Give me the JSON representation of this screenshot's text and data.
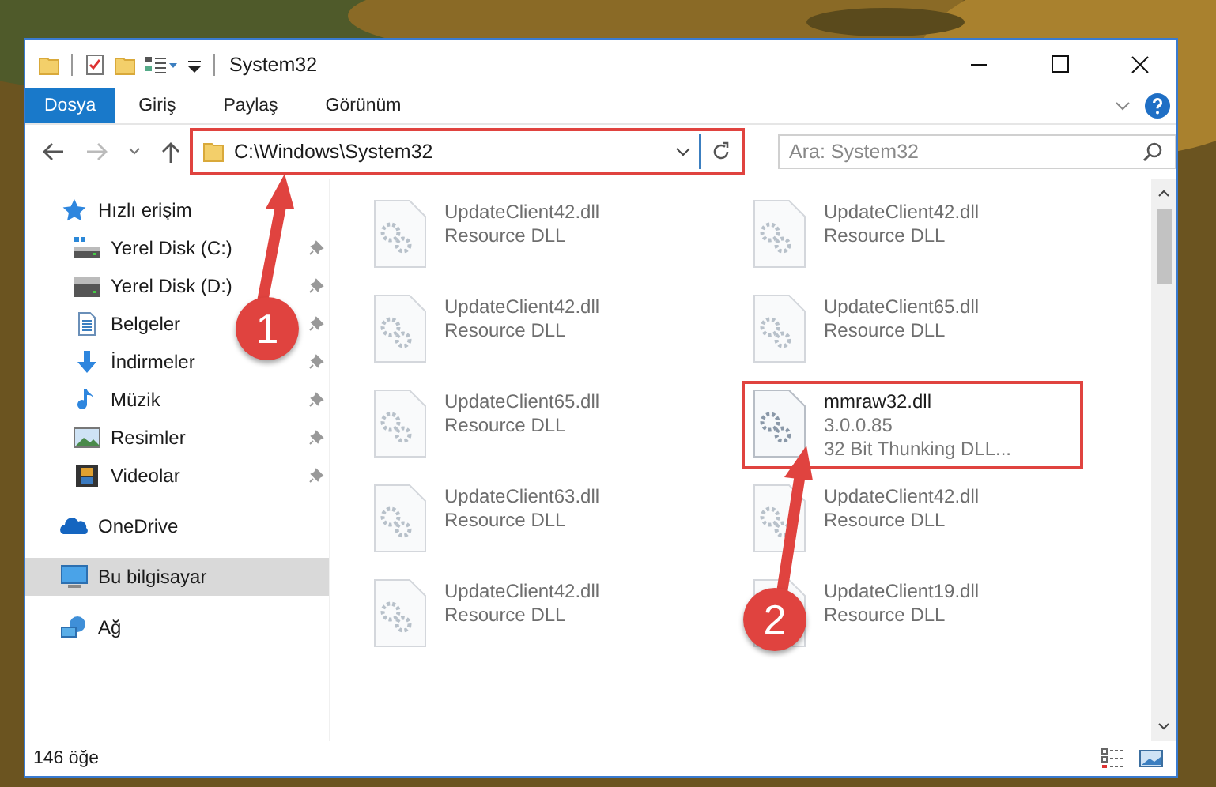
{
  "window": {
    "title": "System32"
  },
  "ribbon_tabs": [
    {
      "label": "Dosya",
      "selected": true
    },
    {
      "label": "Giriş",
      "selected": false
    },
    {
      "label": "Paylaş",
      "selected": false
    },
    {
      "label": "Görünüm",
      "selected": false
    }
  ],
  "address": {
    "path": "C:\\Windows\\System32",
    "highlighted": true
  },
  "search": {
    "placeholder": "Ara: System32"
  },
  "sidebar": {
    "items": [
      {
        "label": "Hızlı erişim",
        "kind": "star",
        "selected": false,
        "children": [
          {
            "label": "Yerel Disk (C:)",
            "kind": "drive-c",
            "pinned": true,
            "selected": false
          },
          {
            "label": "Yerel Disk (D:)",
            "kind": "drive",
            "pinned": true,
            "selected": false
          },
          {
            "label": "Belgeler",
            "kind": "document",
            "pinned": true,
            "selected": false
          },
          {
            "label": "İndirmeler",
            "kind": "download",
            "pinned": true,
            "selected": false
          },
          {
            "label": "Müzik",
            "kind": "music",
            "pinned": true,
            "selected": false
          },
          {
            "label": "Resimler",
            "kind": "pictures",
            "pinned": true,
            "selected": false
          },
          {
            "label": "Videolar",
            "kind": "video",
            "pinned": true,
            "selected": false
          }
        ]
      },
      {
        "label": "OneDrive",
        "kind": "cloud",
        "selected": false
      },
      {
        "label": "Bu bilgisayar",
        "kind": "computer",
        "selected": true
      },
      {
        "label": "Ağ",
        "kind": "network",
        "selected": false
      }
    ]
  },
  "files": [
    {
      "name": "UpdateClient42.dll",
      "details": [
        "Resource DLL"
      ],
      "blurred": true,
      "highlighted": false
    },
    {
      "name": "UpdateClient42.dll",
      "details": [
        "Resource DLL"
      ],
      "blurred": true,
      "highlighted": false
    },
    {
      "name": "UpdateClient42.dll",
      "details": [
        "Resource DLL"
      ],
      "blurred": true,
      "highlighted": false
    },
    {
      "name": "UpdateClient65.dll",
      "details": [
        "Resource DLL"
      ],
      "blurred": true,
      "highlighted": false
    },
    {
      "name": "UpdateClient65.dll",
      "details": [
        "Resource DLL"
      ],
      "blurred": true,
      "highlighted": false
    },
    {
      "name": "mmraw32.dll",
      "details": [
        "3.0.0.85",
        "32 Bit Thunking DLL..."
      ],
      "blurred": false,
      "highlighted": true
    },
    {
      "name": "UpdateClient63.dll",
      "details": [
        "Resource DLL"
      ],
      "blurred": true,
      "highlighted": false
    },
    {
      "name": "UpdateClient42.dll",
      "details": [
        "Resource DLL"
      ],
      "blurred": true,
      "highlighted": false
    },
    {
      "name": "UpdateClient42.dll",
      "details": [
        "Resource DLL"
      ],
      "blurred": true,
      "highlighted": false
    },
    {
      "name": "UpdateClient19.dll",
      "details": [
        "Resource DLL"
      ],
      "blurred": true,
      "highlighted": false
    }
  ],
  "status_bar": {
    "count": "146 öğe"
  },
  "callouts": [
    {
      "number": "1"
    },
    {
      "number": "2"
    }
  ]
}
